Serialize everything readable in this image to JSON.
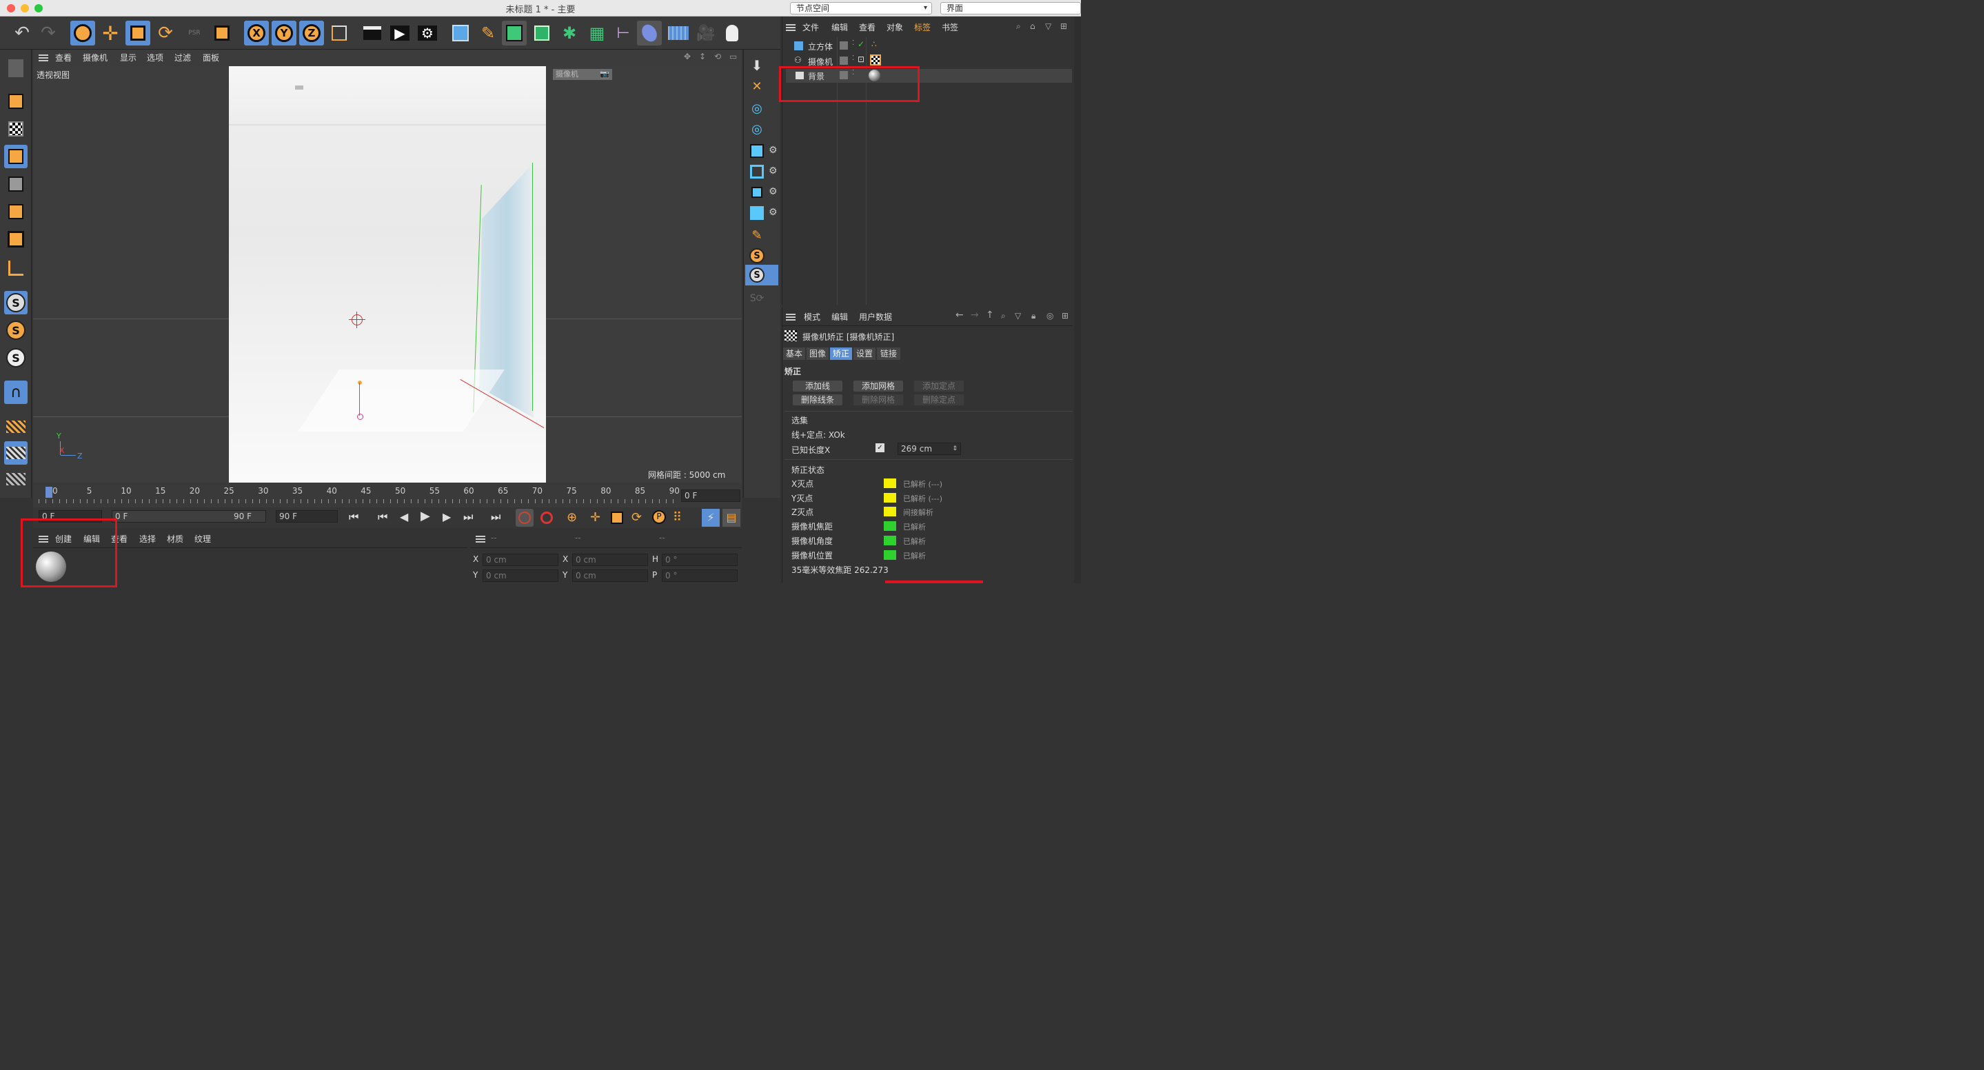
{
  "window": {
    "title": "未标题 1 * - 主要",
    "node_space": "节点空间",
    "layout": "界面"
  },
  "viewport": {
    "menu": [
      "查看",
      "摄像机",
      "显示",
      "选项",
      "过滤",
      "面板"
    ],
    "label": "透视视图",
    "camera_tag": "摄像机",
    "grid_spacing": "网格间距 : 5000 cm",
    "axis_y": "Y",
    "axis_x": "X",
    "axis_z": "Z"
  },
  "timeline": {
    "ticks": [
      "0",
      "5",
      "10",
      "15",
      "20",
      "25",
      "30",
      "35",
      "40",
      "45",
      "50",
      "55",
      "60",
      "65",
      "70",
      "75",
      "80",
      "85",
      "90"
    ],
    "current_frame": "0 F",
    "start": "0 F",
    "range_start": "0 F",
    "range_end": "90 F",
    "end": "90 F"
  },
  "materials": {
    "menu": [
      "创建",
      "编辑",
      "查看",
      "选择",
      "材质",
      "纹理"
    ]
  },
  "coords": {
    "headers": [
      "--",
      "--",
      "--"
    ],
    "rows": [
      {
        "l1": "X",
        "v1": "0 cm",
        "l2": "X",
        "v2": "0 cm",
        "l3": "H",
        "v3": "0 °"
      },
      {
        "l1": "Y",
        "v1": "0 cm",
        "l2": "Y",
        "v2": "0 cm",
        "l3": "P",
        "v3": "0 °"
      }
    ]
  },
  "objects": {
    "menu": [
      "文件",
      "编辑",
      "查看",
      "对象",
      "标签",
      "书签"
    ],
    "items": [
      {
        "name": "立方体"
      },
      {
        "name": "摄像机"
      },
      {
        "name": "背景"
      }
    ]
  },
  "attributes": {
    "menu": [
      "模式",
      "编辑",
      "用户数据"
    ],
    "header": "摄像机矫正 [摄像机矫正]",
    "tabs": [
      "基本",
      "图像",
      "矫正",
      "设置",
      "链接"
    ],
    "section": "矫正",
    "buttons": [
      "添加线",
      "添加网格",
      "添加定点",
      "删除线条",
      "删除网格",
      "删除定点"
    ],
    "selection_title": "选集",
    "selection_value": "线+定点: XOk",
    "known_length_label": "已知长度X",
    "known_length_value": "269 cm",
    "status_title": "矫正状态",
    "status": [
      {
        "label": "X灭点",
        "value": "已解析 (---)",
        "color": "#f5f000"
      },
      {
        "label": "Y灭点",
        "value": "已解析 (---)",
        "color": "#f5f000"
      },
      {
        "label": "Z灭点",
        "value": "间接解析",
        "color": "#f5f000"
      },
      {
        "label": "摄像机焦距",
        "value": "已解析",
        "color": "#2ed12e"
      },
      {
        "label": "摄像机角度",
        "value": "已解析",
        "color": "#2ed12e"
      },
      {
        "label": "摄像机位置",
        "value": "已解析",
        "color": "#2ed12e"
      }
    ],
    "focal": "35毫米等效焦距 262.273"
  },
  "colors": {
    "accent": "#f4a742",
    "selected": "#5b8fd6",
    "highlight": "#e0141e"
  }
}
